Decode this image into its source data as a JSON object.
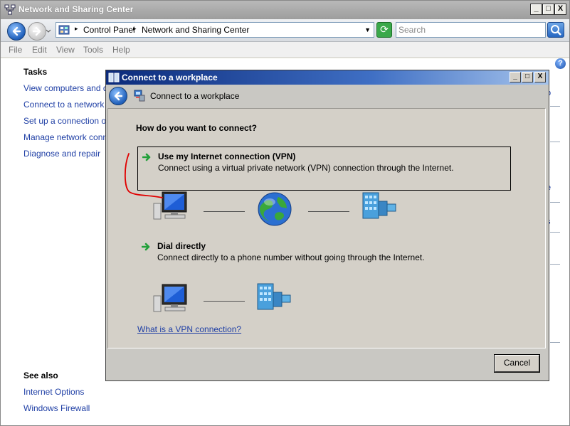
{
  "window": {
    "title": "Network and Sharing Center",
    "caption_buttons": [
      "_",
      "□",
      "X"
    ]
  },
  "navbar": {
    "breadcrumbs": [
      "Control Panel",
      "Network and Sharing Center"
    ],
    "search_placeholder": "Search"
  },
  "menu": [
    "File",
    "Edit",
    "View",
    "Tools",
    "Help"
  ],
  "left_pane": {
    "tasks_heading": "Tasks",
    "tasks": [
      "View computers and devices",
      "Connect to a network",
      "Set up a connection or network",
      "Manage network connections",
      "Diagnose and repair"
    ],
    "see_also_heading": "See also",
    "see_also": [
      "Internet Options",
      "Windows Firewall"
    ]
  },
  "background_fragments": [
    "p",
    "e",
    "s"
  ],
  "dialog": {
    "title": "Connect to a workplace",
    "header": "Connect to a workplace",
    "question": "How do you want to connect?",
    "options": [
      {
        "title": "Use my Internet connection (VPN)",
        "description": "Connect using a virtual private network (VPN) connection through the Internet.",
        "selected": true
      },
      {
        "title": "Dial directly",
        "description": "Connect directly to a phone number without going through the Internet.",
        "selected": false
      }
    ],
    "help_link": "What is a VPN connection?",
    "cancel_label": "Cancel"
  },
  "colors": {
    "link": "#1f3fa5",
    "dialog_title_start": "#0b2a7a",
    "dialog_title_end": "#a6c4ec",
    "annotation_red": "#e00000",
    "arrow_green": "#22a03a"
  },
  "icons": [
    "network-icon",
    "back-arrow-icon",
    "forward-arrow-icon",
    "control-panel-icon",
    "refresh-icon",
    "search-icon",
    "help-icon",
    "workplace-icon",
    "green-arrow-icon",
    "computer-icon",
    "globe-icon",
    "corporate-building-icon"
  ]
}
